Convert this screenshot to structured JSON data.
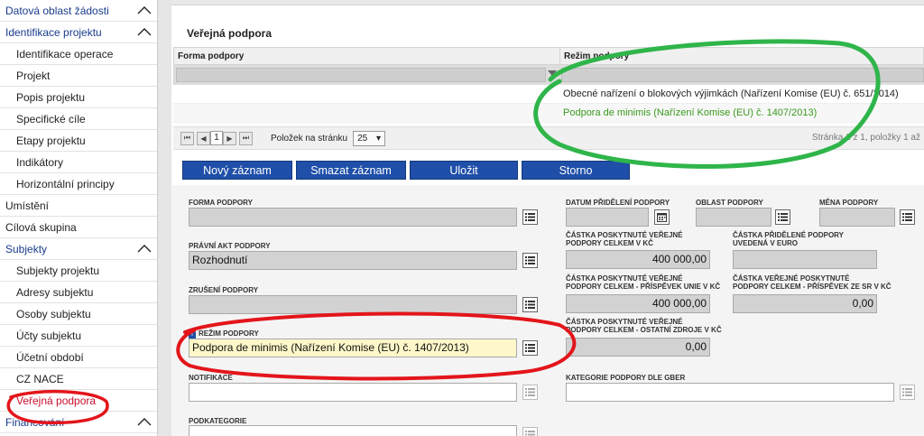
{
  "sidebar": {
    "items": [
      {
        "label": "Datová oblast žádosti",
        "kind": "section",
        "chevron": "chevron-up"
      },
      {
        "label": "Identifikace projektu",
        "kind": "section",
        "chevron": "chevron-up"
      },
      {
        "label": "Identifikace operace",
        "kind": "sub"
      },
      {
        "label": "Projekt",
        "kind": "sub"
      },
      {
        "label": "Popis projektu",
        "kind": "sub"
      },
      {
        "label": "Specifické cíle",
        "kind": "sub"
      },
      {
        "label": "Etapy projektu",
        "kind": "sub"
      },
      {
        "label": "Indikátory",
        "kind": "sub"
      },
      {
        "label": "Horizontální principy",
        "kind": "sub"
      },
      {
        "label": "Umístění",
        "kind": "top"
      },
      {
        "label": "Cílová skupina",
        "kind": "top"
      },
      {
        "label": "Subjekty",
        "kind": "section",
        "chevron": "chevron-up"
      },
      {
        "label": "Subjekty projektu",
        "kind": "sub"
      },
      {
        "label": "Adresy subjektu",
        "kind": "sub"
      },
      {
        "label": "Osoby subjektu",
        "kind": "sub"
      },
      {
        "label": "Účty subjektu",
        "kind": "sub"
      },
      {
        "label": "Účetní období",
        "kind": "sub"
      },
      {
        "label": "CZ NACE",
        "kind": "sub"
      },
      {
        "label": "Veřejná podpora",
        "kind": "sub",
        "active": true
      },
      {
        "label": "Financování",
        "kind": "section",
        "chevron": "chevron-up"
      }
    ]
  },
  "panel": {
    "title": "Veřejná podpora"
  },
  "grid": {
    "columns": [
      "Forma podpory",
      "Režim podpory"
    ],
    "rows": [
      {
        "forma": "",
        "rezim": "Obecné nařízení o blokových výjimkách (Nařízení Komise (EU) č. 651/2014)"
      },
      {
        "forma": "",
        "rezim": "Podpora de minimis (Nařízení Komise (EU) č. 1407/2013)"
      }
    ]
  },
  "pager": {
    "page": "1",
    "per_page_label": "Položek na stránku",
    "per_page_value": "25",
    "info": "Stránka 1 z 1, položky 1 až"
  },
  "buttons": {
    "new": "Nový záznam",
    "delete": "Smazat záznam",
    "save": "Uložit",
    "cancel": "Storno"
  },
  "form": {
    "forma_podpory": {
      "label": "Forma podpory",
      "value": ""
    },
    "pravni_akt": {
      "label": "Právní akt podpory",
      "value": "Rozhodnutí"
    },
    "zruseni": {
      "label": "Zrušení podpory",
      "value": ""
    },
    "rezim": {
      "label": "Režim podpory",
      "value": "Podpora de minimis (Nařízení Komise (EU) č. 1407/2013)"
    },
    "notifikace": {
      "label": "Notifikace",
      "value": ""
    },
    "podkategorie": {
      "label": "Podkategorie",
      "value": ""
    },
    "datum": {
      "label": "Datum přidělení podpory",
      "value": ""
    },
    "oblast": {
      "label": "Oblast podpory",
      "value": ""
    },
    "mena": {
      "label": "Měna podpory",
      "value": ""
    },
    "castka_celkem": {
      "label1": "Částka poskytnuté veřejné",
      "label2": "podpory celkem v Kč",
      "value": "400 000,00"
    },
    "castka_euro": {
      "label1": "Částka přidělené podpory",
      "label2": "uvedená v euro",
      "value": ""
    },
    "castka_unie": {
      "label1": "Částka poskytnuté veřejné",
      "label2": "podpory celkem - příspěvek Unie v Kč",
      "value": "400 000,00"
    },
    "castka_sr": {
      "label1": "Částka veřejné poskytnuté",
      "label2": "podpory celkem - příspěvek ze SR v Kč",
      "value": "0,00"
    },
    "castka_ostatni": {
      "label1": "Částka poskytnuté veřejné",
      "label2": "podpory celkem - ostatní zdroje v Kč",
      "value": "0,00"
    },
    "gber": {
      "label": "Kategorie podpory dle GBER",
      "value": ""
    }
  },
  "colors": {
    "accent": "#1f4fa8",
    "section_text": "#1a3c8c",
    "active_text": "#c8102e",
    "annotation_green": "#2fb54a",
    "annotation_red": "#e3151b",
    "mandatory_field": "#fdf7c9"
  }
}
